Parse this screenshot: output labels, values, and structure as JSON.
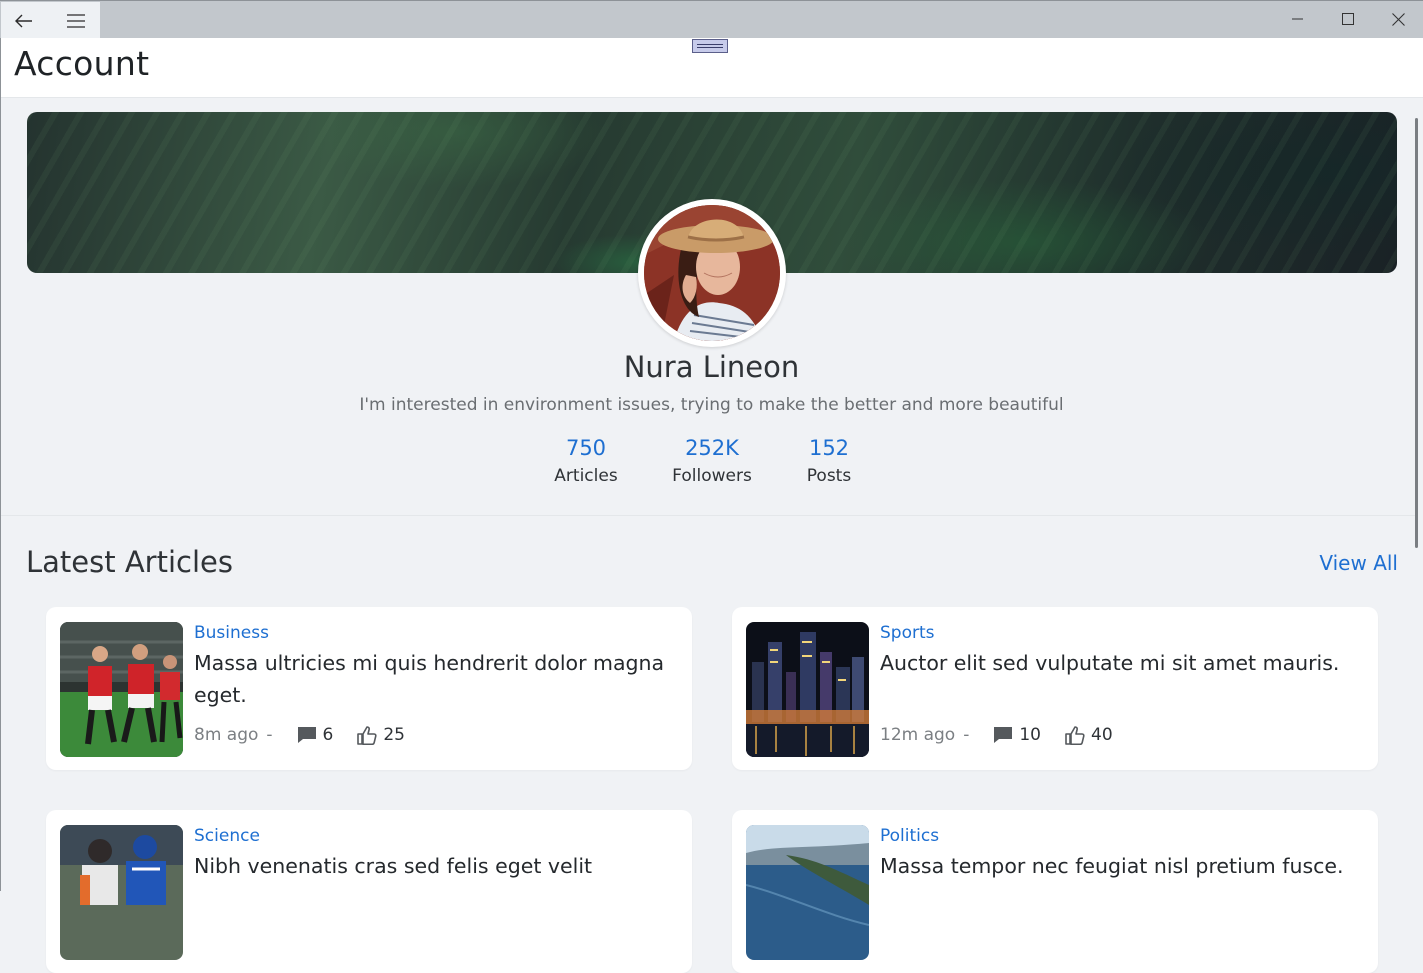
{
  "window": {
    "icons": {
      "back": "back-arrow-icon",
      "menu": "hamburger-menu-icon",
      "minimize": "minimize-icon",
      "maximize": "maximize-icon",
      "close": "close-icon"
    }
  },
  "header": {
    "title": "Account"
  },
  "profile": {
    "name": "Nura Lineon",
    "bio": "I'm interested in environment issues, trying to make the better and more beautiful",
    "stats": [
      {
        "value": "750",
        "label": "Articles"
      },
      {
        "value": "252K",
        "label": "Followers"
      },
      {
        "value": "152",
        "label": "Posts"
      }
    ]
  },
  "articles_section": {
    "title": "Latest Articles",
    "view_all": "View All",
    "articles": [
      {
        "category": "Business",
        "headline": "Massa ultricies mi quis hendrerit dolor magna eget.",
        "time": "8m ago",
        "separator": "-",
        "comments": "6",
        "likes": "25",
        "thumbnail": "soccer-players"
      },
      {
        "category": "Sports",
        "headline": "Auctor elit sed vulputate mi sit amet mauris.",
        "time": "12m ago",
        "separator": "-",
        "comments": "10",
        "likes": "40",
        "thumbnail": "city-night-skyline"
      },
      {
        "category": "Science",
        "headline": "Nibh venenatis cras sed felis eget velit",
        "time": "",
        "separator": "",
        "comments": "",
        "likes": "",
        "thumbnail": "football-game"
      },
      {
        "category": "Politics",
        "headline": "Massa tempor nec feugiat nisl pretium fusce.",
        "time": "",
        "separator": "",
        "comments": "",
        "likes": "",
        "thumbnail": "coastline-sea"
      }
    ]
  },
  "colors": {
    "accent": "#1e6fd1",
    "background": "#f0f2f5",
    "titlebar": "#c2c7cc"
  }
}
